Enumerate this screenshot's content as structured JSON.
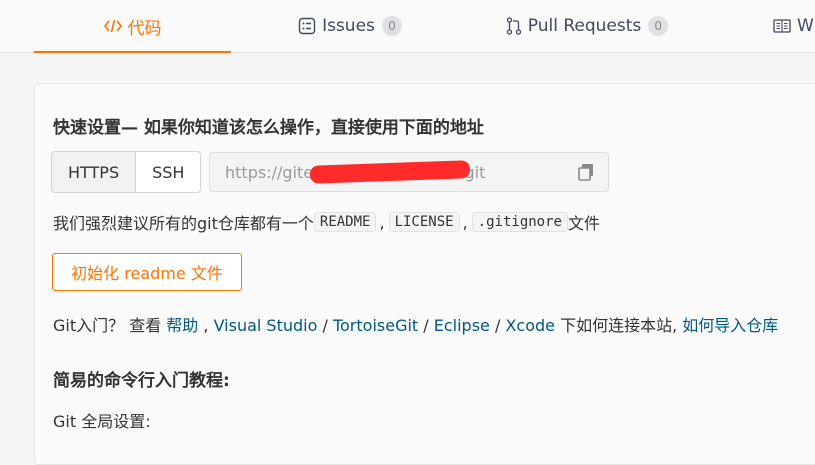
{
  "tabs": [
    {
      "label": "代码",
      "icon": "code-icon",
      "active": true
    },
    {
      "label": "Issues",
      "badge": "0",
      "icon": "issues-icon"
    },
    {
      "label": "Pull Requests",
      "badge": "0",
      "icon": "pull-request-icon"
    },
    {
      "label": "Wi",
      "icon": "wiki-icon"
    }
  ],
  "setup": {
    "heading": "快速设置— 如果你知道该怎么操作，直接使用下面的地址",
    "protocols": [
      "HTTPS",
      "SSH"
    ],
    "url_value": "https://gitee.com/        /         .git",
    "copy_icon": "copy-icon"
  },
  "recommend": {
    "prefix": "我们强烈建议所有的git仓库都有一个",
    "files": [
      "README",
      "LICENSE",
      ".gitignore"
    ],
    "separator": ",",
    "suffix": "文件"
  },
  "init_button": "初始化 readme 文件",
  "help": {
    "prefix": "Git入门？ 查看 ",
    "help_link": "帮助",
    "comma": " , ",
    "tools": [
      "Visual Studio",
      "TortoiseGit",
      "Eclipse",
      "Xcode"
    ],
    "slash": " / ",
    "mid": " 下如何连接本站, ",
    "import_link": "如何导入仓库"
  },
  "tutorial_heading": "简易的命令行入门教程:",
  "git_global": "Git 全局设置:",
  "colors": {
    "accent": "#fe7300",
    "link": "#005980",
    "redaction": "#ff2b2b"
  }
}
